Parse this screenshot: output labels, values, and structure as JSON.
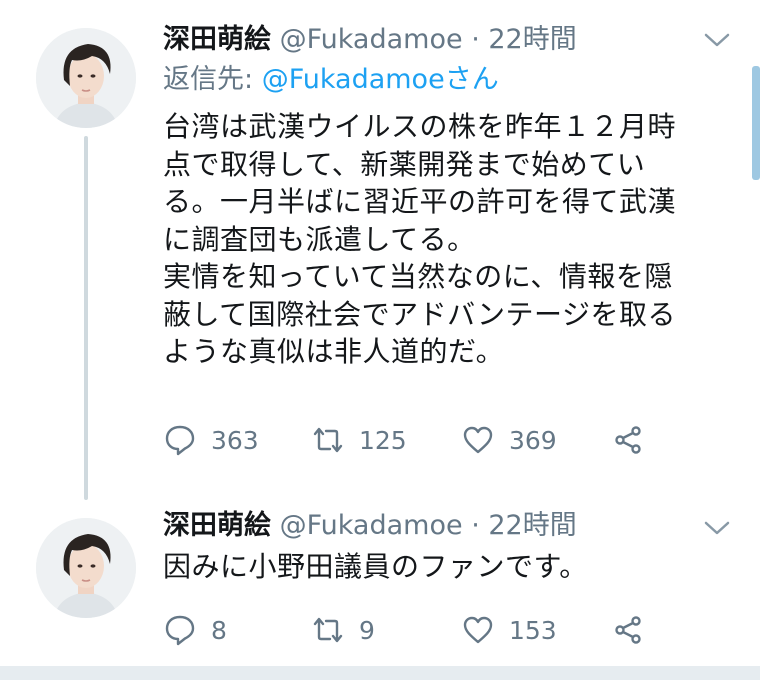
{
  "tweets": [
    {
      "author_name": "深田萌絵",
      "handle": "@Fukadamoe",
      "separator": "·",
      "time": "22時間",
      "reply_to_label": "返信先:",
      "reply_to_handle": "@Fukadamoeさん",
      "body_lines": [
        "台湾は武漢ウイルスの株を昨年１２月時",
        "点で取得して、新薬開発まで始めてい",
        "る。一月半ばに習近平の許可を得て武漢",
        "に調査団も派遣してる。",
        "実情を知っていて当然なのに、情報を隠",
        "蔽して国際社会でアドバンテージを取る",
        "ような真似は非人道的だ。"
      ],
      "replies": "363",
      "retweets": "125",
      "likes": "369"
    },
    {
      "author_name": "深田萌絵",
      "handle": "@Fukadamoe",
      "separator": "·",
      "time": "22時間",
      "body_lines": [
        "因みに小野田議員のファンです。"
      ],
      "replies": "8",
      "retweets": "9",
      "likes": "153"
    }
  ],
  "icons": {
    "reply": "speech-bubble-icon",
    "retweet": "retweet-arrows-icon",
    "like": "heart-icon",
    "share": "share-icon",
    "menu": "chevron-down-icon"
  },
  "colors": {
    "text": "#14171a",
    "secondary": "#657786",
    "link": "#1da1f2",
    "thread_line": "#cfd9de"
  }
}
